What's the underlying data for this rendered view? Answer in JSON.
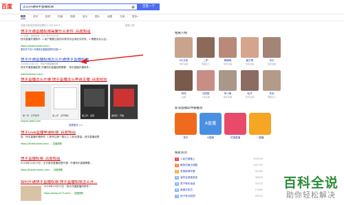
{
  "header": {
    "logo_text": "百度",
    "query": "怎么开通快手直播权限",
    "search_button": "百度一下"
  },
  "tabs": [
    "网页",
    "资讯",
    "贴吧",
    "知道",
    "视频",
    "音乐",
    "图片",
    "地图",
    "文库",
    "更多»"
  ],
  "tool_link": "搜索工具",
  "result_count": "百度为您找到相关结果约1,350,000个",
  "results": [
    {
      "title": "快手开通直播权限需要什么条件_百度知道",
      "meta": "1个回答 - 最新回答: 2017年05月14日",
      "snippet": "快手直播开通条件: 1.用户需要注册快手账号并且绑定手机号。2.需要实名认证...",
      "url": "https://zhidao.baidu.com/...",
      "sub": "更多关于怎么开通快手直播权限的问题>>"
    },
    {
      "title": "快手开通直播权限怎么开通快手直播权限",
      "meta": "2018年10月24日 - 快手开通直播权限...",
      "snippet": "快手开通直播权限 开通快手直播权限需要... 快手直播开通条件...",
      "url": "www.kuaishou.com/...",
      "sub": "百度快照"
    },
    {
      "title": "快手直播怎么开通 快手直播怎么申请主播_百度经验",
      "video_labels": [
        "00:28",
        "02:16",
        "03:50",
        "01:05"
      ],
      "captions": [
        "第一步：打开快手",
        "第二步：点开侧栏",
        "第三步：设置",
        "第四步：开播"
      ],
      "url": "jingyan.baidu.com",
      "more": "查看更多 >>"
    },
    {
      "title": "快手Live直播申请权限_百度知道",
      "snippet": "答：快手直播开通条件: 1.账号注册一周以上 2.粉丝数量...快手直播权限",
      "url": "https://zhidao.baidu.com/... - 百度快照"
    },
    {
      "title": "快手直播权限_百度知道",
      "snippet": "2018年12月13日 - 正式版本直播权限开通...开通快手直播需要...",
      "url": "https://jingyan.baidu.com/... - 百度快照"
    },
    {
      "title": "如何开通快手直播权限 快手直播权限怎么开...",
      "snippet": "2018年12月13日 - 快手开通直播的条件...",
      "url": "https://www.yi173.com/... - 百度快照"
    }
  ],
  "right": {
    "people_heading": "相关人物",
    "people": [
      {
        "name": "MC天佑",
        "sub": "快手主播",
        "color": "#c9a48c"
      },
      {
        "name": "二驴",
        "sub": "网络红人",
        "color": "#8b6a5a"
      },
      {
        "name": "牌牌琦",
        "sub": "快手主播",
        "color": "#b98a7a"
      },
      {
        "name": "散打哥",
        "sub": "快手主播",
        "color": "#d4a58c"
      },
      {
        "name": "辛巴",
        "sub": "快手主播",
        "color": "#a48474"
      },
      {
        "name": "球球",
        "sub": "主播",
        "color": "#7a5a4a"
      },
      {
        "name": "冯提莫",
        "sub": "斗鱼主播",
        "color": "#c88d85"
      },
      {
        "name": "李小萌",
        "sub": "快手主播",
        "color": "#a9978a"
      },
      {
        "name": "仙洋",
        "sub": "快手主播",
        "color": "#8c6b60"
      },
      {
        "name": "宋宋",
        "sub": "网络红人",
        "color": "#b49a88"
      }
    ],
    "apps_heading": "新浪直播软件都推荐",
    "apps": [
      {
        "name": "快手",
        "color": "#f06a1e",
        "label": ""
      },
      {
        "name": "A直播",
        "color": "#4a90e2",
        "label": "A直播"
      },
      {
        "name": "花椒直播",
        "color": "#e84a6a",
        "label": ""
      },
      {
        "name": "一直播",
        "color": "#f5a623",
        "label": ""
      }
    ],
    "hot_heading": "搜索热点",
    "hot": [
      {
        "rank": "1",
        "text": "人民日报晚上",
        "count": "459290",
        "color": "#f54545"
      },
      {
        "rank": "2",
        "text": "教练员暗中调整",
        "count": "447755",
        "color": "#ff8547"
      },
      {
        "rank": "3",
        "text": "央视新闻专题",
        "count": "43185",
        "color": "#ffac38"
      },
      {
        "rank": "4",
        "text": "演员全部被官宣",
        "count": "36905",
        "color": "#8eb9f5"
      },
      {
        "rank": "5",
        "text": "男子驾车追逐",
        "count": "31522",
        "color": "#8eb9f5"
      },
      {
        "rank": "6",
        "text": "美国宇航员",
        "count": "27480",
        "color": "#8eb9f5"
      },
      {
        "rank": "7",
        "text": "孩子考试成绩",
        "count": "26701",
        "color": "#8eb9f5"
      }
    ]
  },
  "watermark": {
    "line1": "百科全说",
    "line2": "助你轻松解决"
  }
}
